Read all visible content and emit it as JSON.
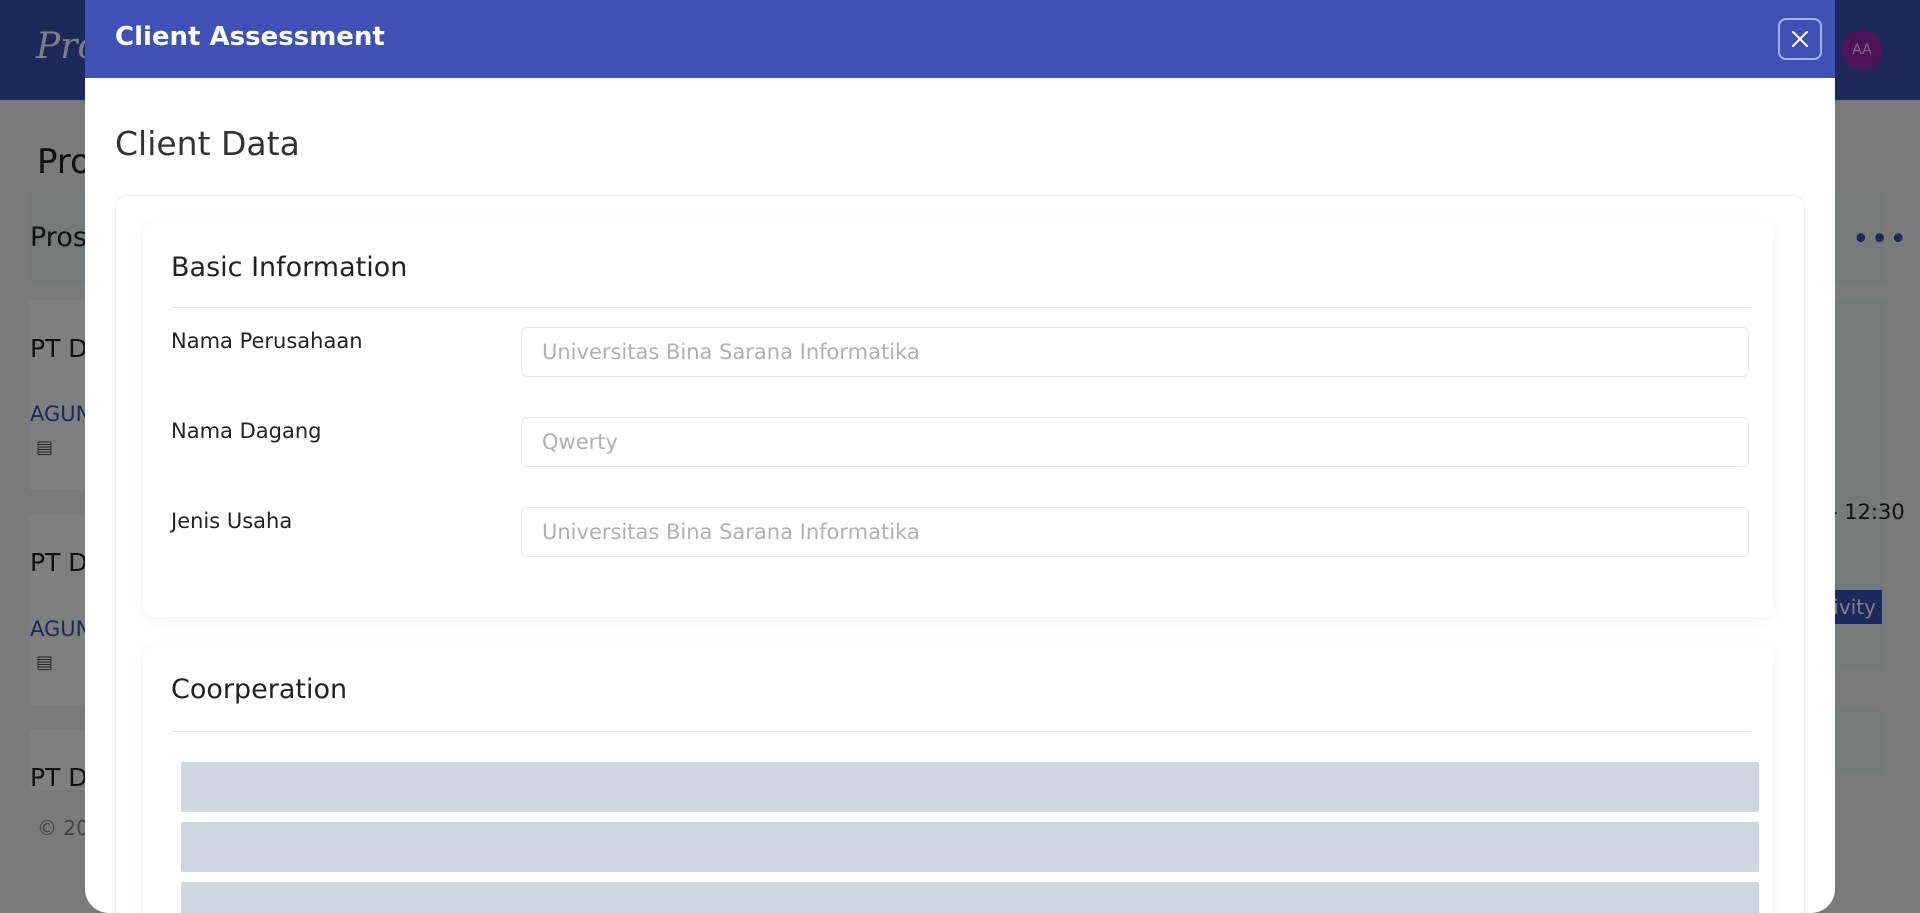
{
  "background_app": {
    "logo_text": "Pro",
    "page_title_partial": "Pro",
    "section_title_partial": "Pros",
    "cards": [
      {
        "title_partial": "PT DU",
        "link_partial": "AGUN"
      },
      {
        "title_partial": "PT DU",
        "link_partial": "AGUN"
      },
      {
        "title_partial": "PT DU"
      }
    ],
    "time_partial": "- 12:30",
    "activity_button_partial": "ivity",
    "footer_partial": "© 20",
    "user_avatar_initials": "AA"
  },
  "modal": {
    "title": "Client Assessment",
    "client_data_heading": "Client Data",
    "basic_information": {
      "heading": "Basic Information",
      "fields": [
        {
          "label": "Nama Perusahaan",
          "placeholder": "Universitas Bina Sarana Informatika"
        },
        {
          "label": "Nama Dagang",
          "placeholder": "Qwerty"
        },
        {
          "label": "Jenis Usaha",
          "placeholder": "Universitas Bina Sarana Informatika"
        }
      ]
    },
    "cooperation": {
      "heading": "Coorperation",
      "loading_rows": 3
    }
  },
  "colors": {
    "primary": "#3f51b5",
    "avatar": "#9c27b0",
    "skeleton": "#cfd6e0"
  }
}
